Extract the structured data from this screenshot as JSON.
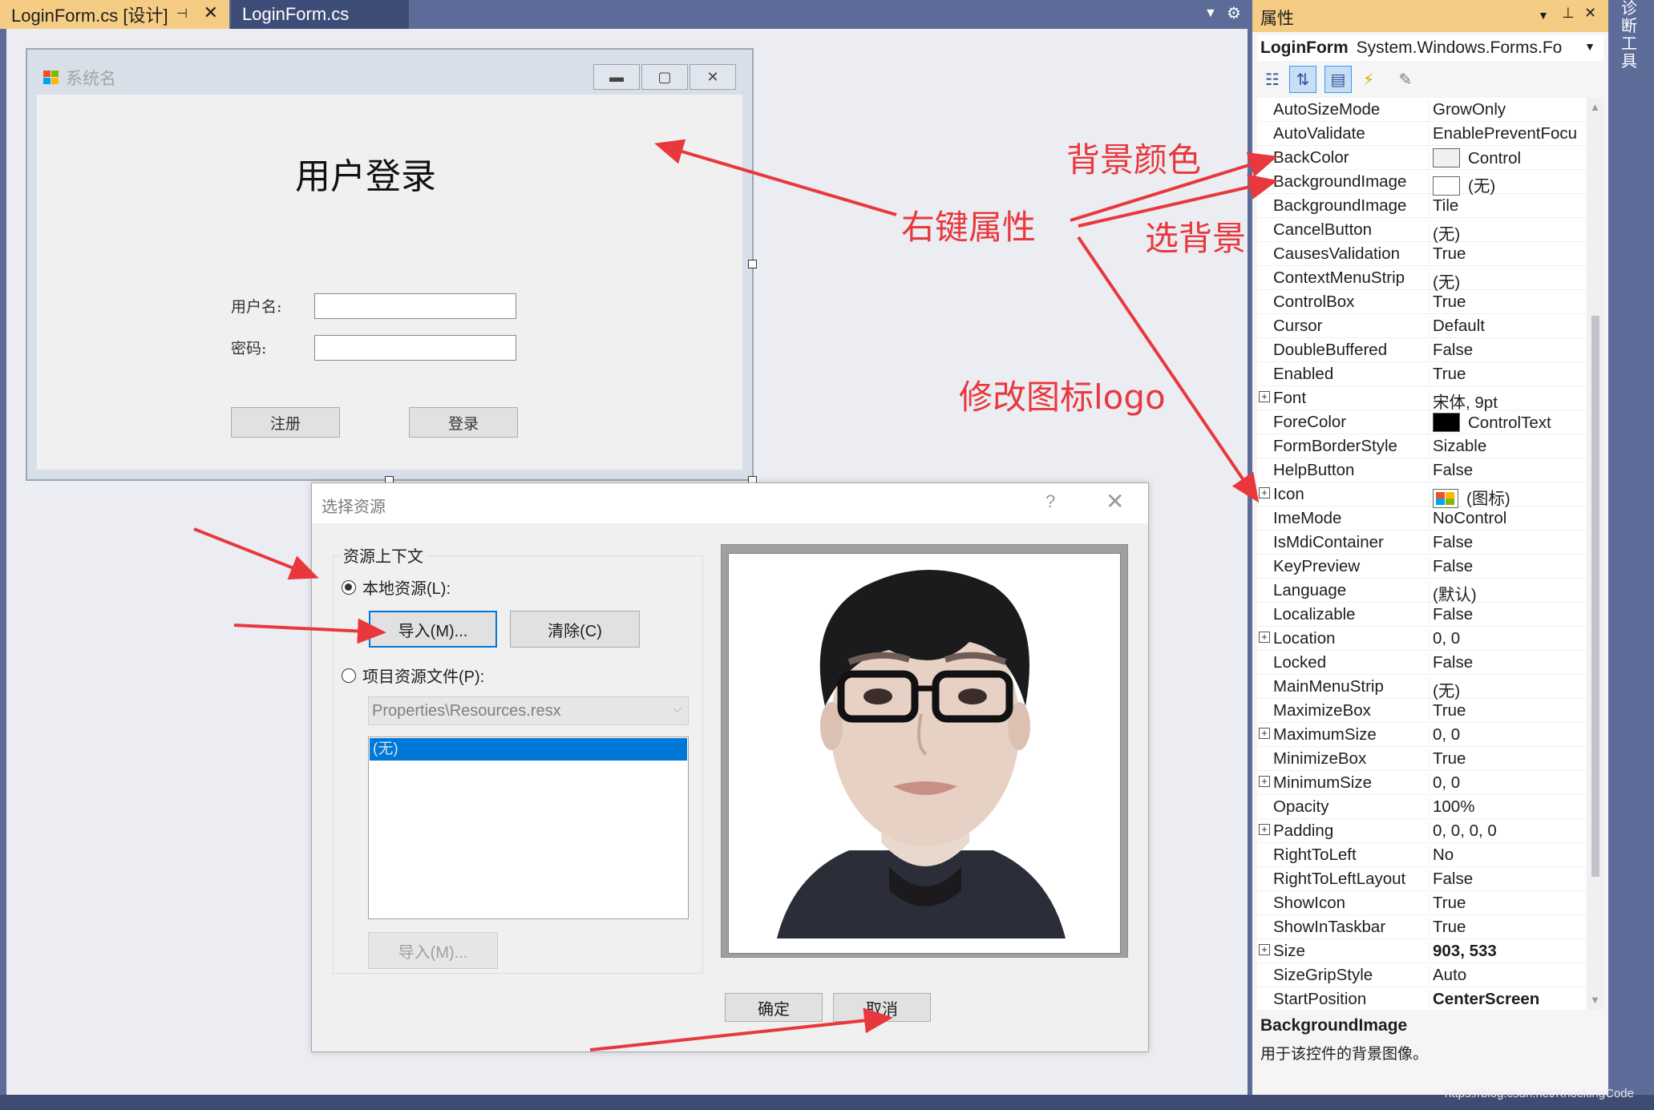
{
  "tabs": {
    "active": "LoginForm.cs [设计]",
    "inactive": "LoginForm.cs"
  },
  "login_form": {
    "title": "系统名",
    "heading": "用户登录",
    "username_label": "用户名:",
    "password_label": "密码:",
    "register_button": "注册",
    "login_button": "登录"
  },
  "resource_dialog": {
    "title": "选择资源",
    "help": "?",
    "group_label": "资源上下文",
    "local_radio": "本地资源(L):",
    "import_button": "导入(M)...",
    "clear_button": "清除(C)",
    "project_radio": "项目资源文件(P):",
    "project_file": "Properties\\Resources.resx",
    "list_selected": "(无)",
    "import_button_disabled": "导入(M)...",
    "ok_button": "确定",
    "cancel_button": "取消"
  },
  "properties": {
    "title": "属性",
    "object_name": "LoginForm",
    "object_type": "System.Windows.Forms.Fo",
    "rows": [
      {
        "name": "AutoSizeMode",
        "value": "GrowOnly"
      },
      {
        "name": "AutoValidate",
        "value": "EnablePreventFocu"
      },
      {
        "name": "BackColor",
        "value": "Control",
        "swatch": "#f0f0f0"
      },
      {
        "name": "BackgroundImage",
        "value": "(无)",
        "swatch": "#ffffff"
      },
      {
        "name": "BackgroundImage",
        "value": "Tile"
      },
      {
        "name": "CancelButton",
        "value": "(无)"
      },
      {
        "name": "CausesValidation",
        "value": "True"
      },
      {
        "name": "ContextMenuStrip",
        "value": "(无)"
      },
      {
        "name": "ControlBox",
        "value": "True"
      },
      {
        "name": "Cursor",
        "value": "Default"
      },
      {
        "name": "DoubleBuffered",
        "value": "False"
      },
      {
        "name": "Enabled",
        "value": "True"
      },
      {
        "name": "Font",
        "value": "宋体, 9pt",
        "expand": true
      },
      {
        "name": "ForeColor",
        "value": "ControlText",
        "swatch": "#000000"
      },
      {
        "name": "FormBorderStyle",
        "value": "Sizable"
      },
      {
        "name": "HelpButton",
        "value": "False"
      },
      {
        "name": "Icon",
        "value": "(图标)",
        "expand": true,
        "icon": true
      },
      {
        "name": "ImeMode",
        "value": "NoControl"
      },
      {
        "name": "IsMdiContainer",
        "value": "False"
      },
      {
        "name": "KeyPreview",
        "value": "False"
      },
      {
        "name": "Language",
        "value": "(默认)"
      },
      {
        "name": "Localizable",
        "value": "False"
      },
      {
        "name": "Location",
        "value": "0, 0",
        "expand": true
      },
      {
        "name": "Locked",
        "value": "False"
      },
      {
        "name": "MainMenuStrip",
        "value": "(无)"
      },
      {
        "name": "MaximizeBox",
        "value": "True"
      },
      {
        "name": "MaximumSize",
        "value": "0, 0",
        "expand": true
      },
      {
        "name": "MinimizeBox",
        "value": "True"
      },
      {
        "name": "MinimumSize",
        "value": "0, 0",
        "expand": true
      },
      {
        "name": "Opacity",
        "value": "100%"
      },
      {
        "name": "Padding",
        "value": "0, 0, 0, 0",
        "expand": true
      },
      {
        "name": "RightToLeft",
        "value": "No"
      },
      {
        "name": "RightToLeftLayout",
        "value": "False"
      },
      {
        "name": "ShowIcon",
        "value": "True"
      },
      {
        "name": "ShowInTaskbar",
        "value": "True"
      },
      {
        "name": "Size",
        "value": "903, 533",
        "expand": true,
        "bold": true
      },
      {
        "name": "SizeGripStyle",
        "value": "Auto"
      },
      {
        "name": "StartPosition",
        "value": "CenterScreen",
        "bold": true
      }
    ],
    "description_title": "BackgroundImage",
    "description_text": "用于该控件的背景图像。"
  },
  "side_strip_label": "诊断工具",
  "annotations": {
    "right_click": "右键属性",
    "back_color": "背景颜色",
    "choose_background": "选背景",
    "change_icon": "修改图标logo"
  },
  "watermark": "https://blog.csdn.net/KnockingCode"
}
